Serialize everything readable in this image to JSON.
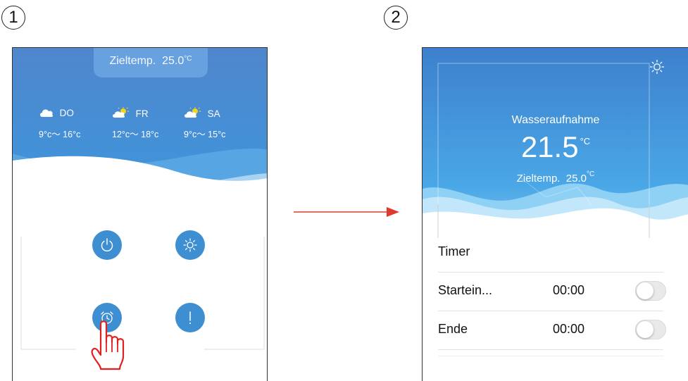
{
  "steps": {
    "one": "1",
    "two": "2"
  },
  "screen1": {
    "target_label": "Zieltemp.",
    "target_value": "25.0",
    "target_unit": "°C",
    "forecast": [
      {
        "day": "DO",
        "icon": "cloud-icon",
        "range": "9°c～ 16°c"
      },
      {
        "day": "FR",
        "icon": "partly-sunny-icon",
        "range": "12°c～ 18°c"
      },
      {
        "day": "SA",
        "icon": "partly-sunny-icon",
        "range": "9°c～ 15°c"
      }
    ],
    "buttons": [
      "power-icon",
      "sun-icon",
      "alarm-clock-icon",
      "exclamation-icon"
    ]
  },
  "screen2": {
    "intake_label": "Wasseraufnahme",
    "intake_value": "21.5",
    "intake_unit": "°C",
    "target_label": "Zieltemp.",
    "target_value": "25.0",
    "target_unit": "°C",
    "timer_title": "Timer",
    "rows": [
      {
        "label": "Startein...",
        "time": "00:00",
        "enabled": false
      },
      {
        "label": "Ende",
        "time": "00:00",
        "enabled": false
      }
    ]
  },
  "colors": {
    "accent_blue": "#3e8fd1",
    "arrow_red": "#e03a2f",
    "hand_red": "#e02020"
  }
}
